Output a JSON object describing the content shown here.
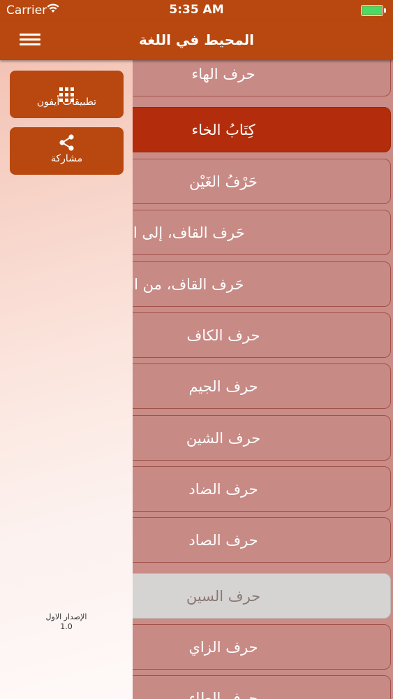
{
  "status_bar": {
    "carrier": "Carrier",
    "time": "5:35 AM"
  },
  "nav": {
    "title": "المحيط في اللغة"
  },
  "drawer": {
    "apps_label": "تطبيقات أيفون",
    "share_label": "مشاركة",
    "version_label": "الإصدار الاول",
    "version_number": "1.0"
  },
  "list": {
    "items": [
      "حرف الهاء",
      "كِتَابُ الخاء",
      "حَرْفُ الغَيْن",
      "حَرف القاف، إلى القاف والراء",
      "حَرف القاف، من القاف والراء",
      "حرف الكاف",
      "حرف الجيم",
      "حرف الشين",
      "حرف الضاد",
      "حرف الصاد",
      "حرف السين",
      "حرف الزاي",
      "حرف الطاء"
    ]
  },
  "colors": {
    "accent": "#b8480f",
    "selected": "#b32d0c",
    "cell": "#c88a85"
  }
}
